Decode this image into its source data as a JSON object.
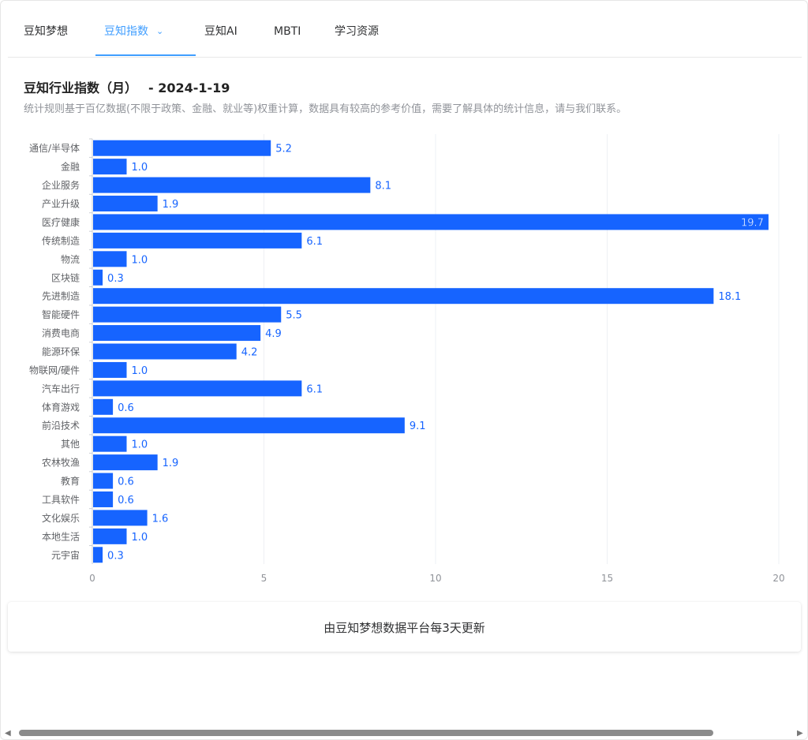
{
  "nav": {
    "tabs": [
      {
        "label": "豆知梦想"
      },
      {
        "label": "豆知指数"
      },
      {
        "label": "豆知AI"
      },
      {
        "label": "MBTI"
      },
      {
        "label": "学习资源"
      }
    ],
    "active_index": 1
  },
  "header": {
    "title": "豆知行业指数（月）",
    "date": "- 2024-1-19",
    "subtitle": "统计规则基于百亿数据(不限于政策、金融、就业等)权重计算，数据具有较高的参考价值，需要了解具体的统计信息，请与我们联系。"
  },
  "chart_data": {
    "type": "bar",
    "orientation": "horizontal",
    "categories": [
      "通信/半导体",
      "金融",
      "企业服务",
      "产业升级",
      "医疗健康",
      "传统制造",
      "物流",
      "区块链",
      "先进制造",
      "智能硬件",
      "消费电商",
      "能源环保",
      "物联网/硬件",
      "汽车出行",
      "体育游戏",
      "前沿技术",
      "其他",
      "农林牧渔",
      "教育",
      "工具软件",
      "文化娱乐",
      "本地生活",
      "元宇宙"
    ],
    "values": [
      5.2,
      1.0,
      8.1,
      1.9,
      19.7,
      6.1,
      1.0,
      0.3,
      18.1,
      5.5,
      4.9,
      4.2,
      1.0,
      6.1,
      0.6,
      9.1,
      1.0,
      1.9,
      0.6,
      0.6,
      1.6,
      1.0,
      0.3
    ],
    "value_labels": [
      "5.2",
      "1.0",
      "8.1",
      "1.9",
      "19.7",
      "6.1",
      "1.0",
      "0.3",
      "18.1",
      "5.5",
      "4.9",
      "4.2",
      "1.0",
      "6.1",
      "0.6",
      "9.1",
      "1.0",
      "1.9",
      "0.6",
      "0.6",
      "1.6",
      "1.0",
      "0.3"
    ],
    "xticks": [
      "0",
      "5",
      "10",
      "15",
      "20"
    ],
    "xlim": [
      0,
      20
    ],
    "grid": true,
    "bar_color": "#1664ff",
    "label_color": "#1664ff"
  },
  "footer": {
    "text": "由豆知梦想数据平台每3天更新"
  },
  "icons": {
    "tab_dropdown": "chevron-down-icon",
    "scroll_left": "triangle-left-icon",
    "scroll_right": "triangle-right-icon"
  }
}
